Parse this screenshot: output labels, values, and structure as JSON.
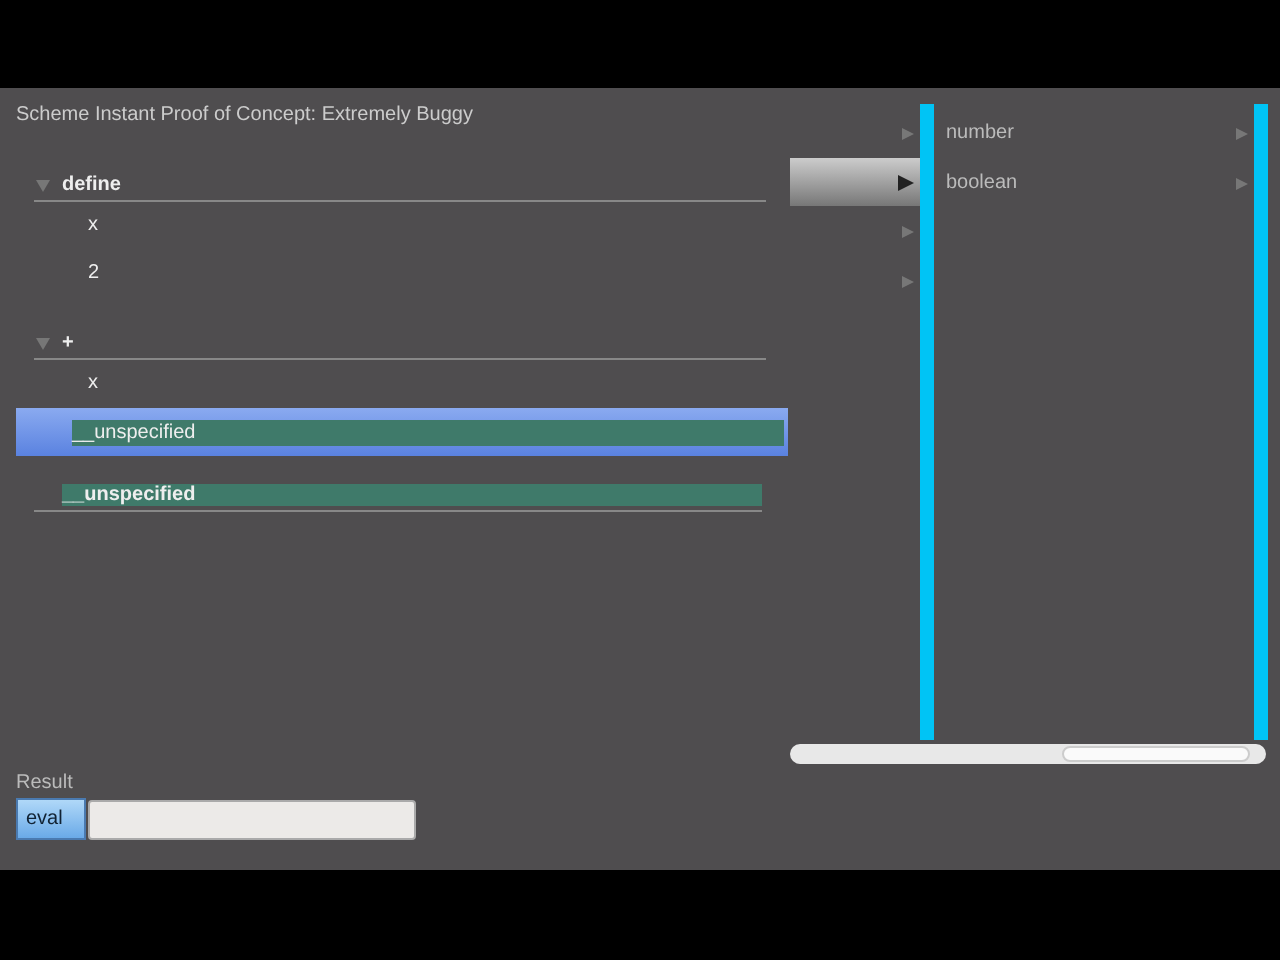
{
  "window": {
    "title": "Scheme Instant Proof of Concept: Extremely Buggy"
  },
  "tree": [
    {
      "label": "define",
      "expanded": true,
      "children": [
        {
          "label": "x",
          "kind": "text",
          "selected": false
        },
        {
          "label": "2",
          "kind": "text",
          "selected": false
        }
      ]
    },
    {
      "label": "+",
      "expanded": true,
      "children": [
        {
          "label": "x",
          "kind": "text",
          "selected": false
        },
        {
          "label": "__unspecified",
          "kind": "value",
          "selected": true
        }
      ]
    }
  ],
  "output": {
    "label": "__unspecified"
  },
  "browser": {
    "columns": [
      {
        "rows": [
          {
            "selected": false
          },
          {
            "selected": true
          },
          {
            "selected": false
          },
          {
            "selected": false
          }
        ]
      },
      {
        "rows": [
          {
            "label": "number",
            "selected": false
          },
          {
            "label": "boolean",
            "selected": false
          }
        ]
      }
    ]
  },
  "result": {
    "label": "Result",
    "button": "eval"
  }
}
